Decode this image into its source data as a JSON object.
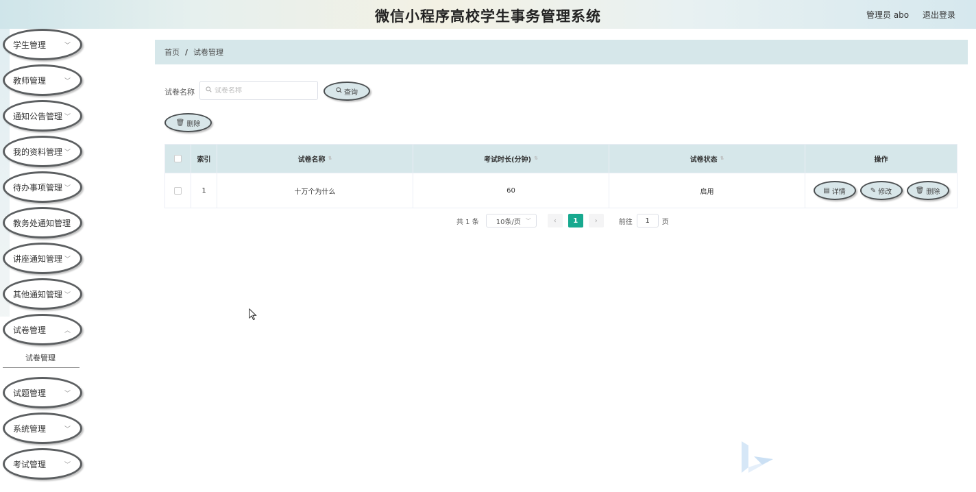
{
  "header": {
    "title": "微信小程序高校学生事务管理系统",
    "user_label": "管理员 abo",
    "logout_label": "退出登录"
  },
  "sidebar": {
    "items": [
      {
        "label": "学生管理"
      },
      {
        "label": "教师管理"
      },
      {
        "label": "通知公告管理"
      },
      {
        "label": "我的资料管理"
      },
      {
        "label": "待办事项管理"
      },
      {
        "label": "教务处通知管理"
      },
      {
        "label": "讲座通知管理"
      },
      {
        "label": "其他通知管理"
      },
      {
        "label": "试卷管理"
      },
      {
        "label": "试题管理"
      },
      {
        "label": "系统管理"
      },
      {
        "label": "考试管理"
      }
    ],
    "submenu_label": "试卷管理"
  },
  "breadcrumb": {
    "home": "首页",
    "separator": "/",
    "current": "试卷管理"
  },
  "search": {
    "label": "试卷名称",
    "placeholder": "试卷名称",
    "value": "",
    "button_label": "查询"
  },
  "toolbar": {
    "delete_label": "删除"
  },
  "table": {
    "headers": {
      "index": "索引",
      "name": "试卷名称",
      "duration": "考试时长(分钟)",
      "status": "试卷状态",
      "ops": "操作"
    },
    "rows": [
      {
        "index": "1",
        "name": "十万个为什么",
        "duration": "60",
        "status": "启用"
      }
    ],
    "row_actions": {
      "detail": "详情",
      "edit": "修改",
      "delete": "删除"
    }
  },
  "pagination": {
    "total": "共 1 条",
    "page_size": "10条/页",
    "prev": "‹",
    "current_page": "1",
    "next": "›",
    "goto_label": "前往",
    "goto_value": "1",
    "page_suffix": "页"
  },
  "colors": {
    "accent": "#17a98f",
    "breadcrumb_bg": "#d6e7ea",
    "button_bg": "#d8e6e9",
    "pill_border": "#5c5f61"
  },
  "icons": {
    "search": "search-icon",
    "delete": "trash-icon",
    "detail": "document-icon",
    "edit": "pencil-icon",
    "dropdown": "chevron-down-icon"
  }
}
